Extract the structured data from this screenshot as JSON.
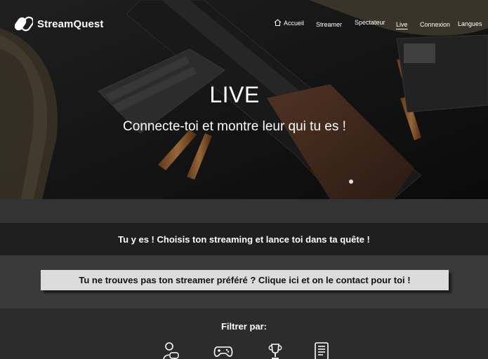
{
  "brand": {
    "name": "StreamQuest"
  },
  "nav": {
    "items": [
      {
        "label": "Accueil",
        "icon": "home-icon"
      },
      {
        "label": "Streamer"
      },
      {
        "label": "Spectateur"
      },
      {
        "label": "Live",
        "active": true
      },
      {
        "label": "Connexion"
      },
      {
        "label": "Langues"
      }
    ]
  },
  "hero": {
    "title": "LIVE",
    "subtitle": "Connecte-toi et montre leur qui tu es !"
  },
  "banner": {
    "text": "Tu y es ! Choisis ton streaming et lance toi dans ta quête !"
  },
  "contact": {
    "label": "Tu ne trouves pas ton streamer préféré ? Clique ici et on le contact pour toi !"
  },
  "filter": {
    "title": "Filtrer par:",
    "icons": [
      "streamer-gamer-icon",
      "gamepad-icon",
      "trophy-icon",
      "document-icon"
    ]
  },
  "colors": {
    "hero_bg": "#1a1a1a",
    "band_dark": "#1f1f1f",
    "band_mid": "#3a3a3a",
    "button_bg": "#dcdcdc"
  }
}
